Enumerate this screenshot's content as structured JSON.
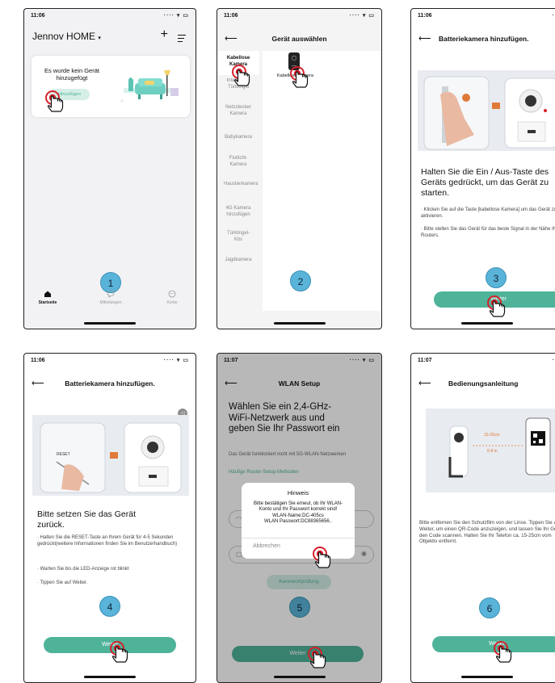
{
  "status": {
    "time_1": "11:06",
    "time_2": "11:06",
    "time_3": "11:06",
    "time_4": "11:06",
    "time_5": "11:07",
    "time_6": "11:07"
  },
  "step_numbers": [
    "1",
    "2",
    "3",
    "4",
    "5",
    "6"
  ],
  "screen1": {
    "app_title": "Jennov HOME",
    "add_icon": "+",
    "empty_text": "Es wurde kein Gerät hinzugefügt",
    "add_button": "Hinzufügen",
    "tabs": [
      "Startseite",
      "Mitteilungen",
      "Konto"
    ]
  },
  "screen2": {
    "title": "Gerät auswählen",
    "categories": [
      "Kabellose Kamera",
      "Intelligente Türklingel",
      "Netzstecker Kamera",
      "Babykamera",
      "Flutlicht-Kamera",
      "Haustierkamera",
      "4G Kamera hinzufügen",
      "Türklingel-Kits",
      "Jagdkamera"
    ],
    "device_label": "Kabellose Kamera"
  },
  "screen3": {
    "title": "Batteriekamera hinzufügen.",
    "heading": "Halten Sie die Ein / Aus-Taste des Geräts gedrückt, um das Gerät zu starten.",
    "bullet1": "· Klicken Sie auf die Taste [kabellose Kamera] um das Gerät zu aktivieren.",
    "bullet2": "· Bitte stellen Sie das Gerät für das beste Signal in der Nähe Ihres Routers.",
    "button": "Weiter"
  },
  "screen4": {
    "title": "Batteriekamera hinzufügen.",
    "reset_label": "RESET",
    "heading": "Bitte setzen Sie das Gerät zurück.",
    "bullet1": "· Halten Sie die RESET-Taste an Ihrem Gerät für 4-5 Sekunden gedrückt(weitere Informationen finden Sie im Benutzerhandbuch)",
    "bullet2": "· Warten Sie bis die LED-Anzeige rot blinkt",
    "bullet3": "· Tippen Sie auf Weiter.",
    "button": "Weiter"
  },
  "screen5": {
    "title": "WLAN Setup",
    "heading": "Wählen Sie ein 2,4-GHz-WiFi-Netzwerk aus und geben Sie Ihr Passwort ein",
    "note": "Das Gerät funktioniert nicht mit 5G-WLAN-Netzwerken",
    "link": "Häufige Router-Setup-Methoden",
    "check_button": "Kennwortprüfung",
    "button": "Weiter",
    "dialog": {
      "title": "Hinweis",
      "message": "Bitte bestätigen Sie erneut, ob Ihr WLAN-Konto und Ihr Passwort korrekt sind!",
      "wlan_name": "WLAN-Name:DC-405cs",
      "wlan_password": "WLAN Passwort:DC88365656..",
      "cancel": "Abbrechen"
    }
  },
  "screen6": {
    "title": "Bedienungsanleitung",
    "distance_cm": "15-25cm",
    "distance_in": "6-8 in",
    "instructions": "Bitte entfernen Sie den Schutzfilm von der Linse. Tippen Sie auf Weiter, um einen QR-Code anzuzeigen, und lassen Sie Ihr Gerät den Code scannen. Halten Sie Ihr Telefon ca. 15-25cm vom Objektiv entfernt.",
    "button": "Weiter"
  },
  "colors": {
    "accent_green": "#4fb39a",
    "step_badge": "#5ab3d8",
    "pointer_red": "#d6202a"
  }
}
